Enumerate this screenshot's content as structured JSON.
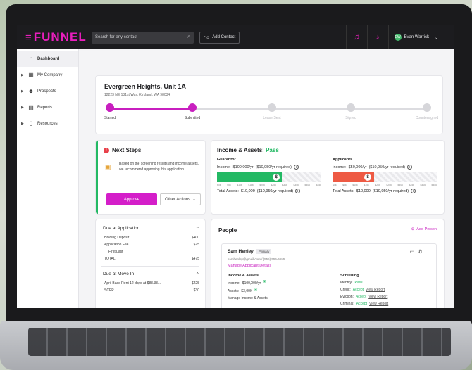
{
  "app": {
    "logo": "FUNNEL"
  },
  "topbar": {
    "search_placeholder": "Search for any contact",
    "add_contact": "Add Contact",
    "user_initials": "EW",
    "user_name": "Evan Warrick"
  },
  "sidebar": {
    "items": [
      {
        "label": "Dashboard",
        "icon": "car-icon",
        "glyph": "⌂"
      },
      {
        "label": "My Company",
        "icon": "building-icon",
        "glyph": "▦"
      },
      {
        "label": "Prospects",
        "icon": "people-icon",
        "glyph": "☻"
      },
      {
        "label": "Reports",
        "icon": "chart-icon",
        "glyph": "▤"
      },
      {
        "label": "Resources",
        "icon": "document-icon",
        "glyph": "▯"
      }
    ]
  },
  "property": {
    "title": "Evergreen Heights, Unit 1A",
    "address": "12223 NE 131st Way, Kirkland, WA 98034",
    "steps": [
      {
        "label": "Started",
        "done": true
      },
      {
        "label": "Submitted",
        "done": true
      },
      {
        "label": "Lease Sent",
        "done": false
      },
      {
        "label": "Signed",
        "done": false
      },
      {
        "label": "Countersigned",
        "done": false
      }
    ]
  },
  "next_steps": {
    "title": "Next Steps",
    "text": "Based on the screening results and income/assets, we recommend approving this application.",
    "approve": "Approve",
    "other": "Other Actions"
  },
  "income": {
    "title": "Income & Assets:",
    "status": "Pass",
    "guarantor": {
      "heading": "Guarantor",
      "income_label": "Income:",
      "income_value": "$100,000/yr",
      "required": "($10,950/yr required)",
      "fill_fraction": 0.63,
      "fill_color": "#23b964",
      "total_label": "Total Assets:",
      "total_value": "$10,000",
      "total_required": "($10,950/yr required)"
    },
    "applicants": {
      "heading": "Applicants",
      "income_label": "Income:",
      "income_value": "$50,000/yr",
      "required": "($10,950/yr required)",
      "fill_fraction": 0.4,
      "fill_color": "#ee5a44",
      "total_label": "Total Assets:",
      "total_value": "$10,000",
      "total_required": "($10,950/yr required)"
    },
    "ticks": [
      "$0k",
      "$5k",
      "$10k",
      "$15k",
      "$20k",
      "$25k",
      "$30k",
      "$35k",
      "$40k",
      "$45k"
    ]
  },
  "due": {
    "at_application": "Due at Application",
    "rows1": [
      {
        "label": "Holding Deposit",
        "value": "$400"
      },
      {
        "label": "Application Fee",
        "value": "$75"
      },
      {
        "label": "First Last",
        "value": ""
      },
      {
        "label": "TOTAL",
        "value": "$475"
      }
    ],
    "at_move_in": "Due at Move In",
    "rows2": [
      {
        "label": "April Base Rent 12 days at $83.33...",
        "value": "$225"
      },
      {
        "label": "SCEP",
        "value": "$30"
      }
    ]
  },
  "people": {
    "title": "People",
    "add": "Add Person",
    "person": {
      "name": "Sam Henley",
      "badge": "Primary",
      "contact": "samhenley@gmail.com / (555) 555-5555",
      "manage": "Manage Applicant Details",
      "income_heading": "Income & Assets",
      "income_label": "Income:",
      "income_value": "$100,000/yr",
      "assets_label": "Assets:",
      "assets_value": "$3,000",
      "manage_income": "Manage Income & Assets",
      "screening_heading": "Screening",
      "identity_label": "Identity:",
      "identity_value": "Pass",
      "credit_label": "Credit:",
      "credit_value": "Accept",
      "credit_link": "View Report",
      "eviction_label": "Eviction:",
      "eviction_value": "Accept",
      "eviction_link": "View Report",
      "criminal_label": "Criminal:",
      "criminal_value": "Accept",
      "criminal_link": "View Report"
    }
  }
}
